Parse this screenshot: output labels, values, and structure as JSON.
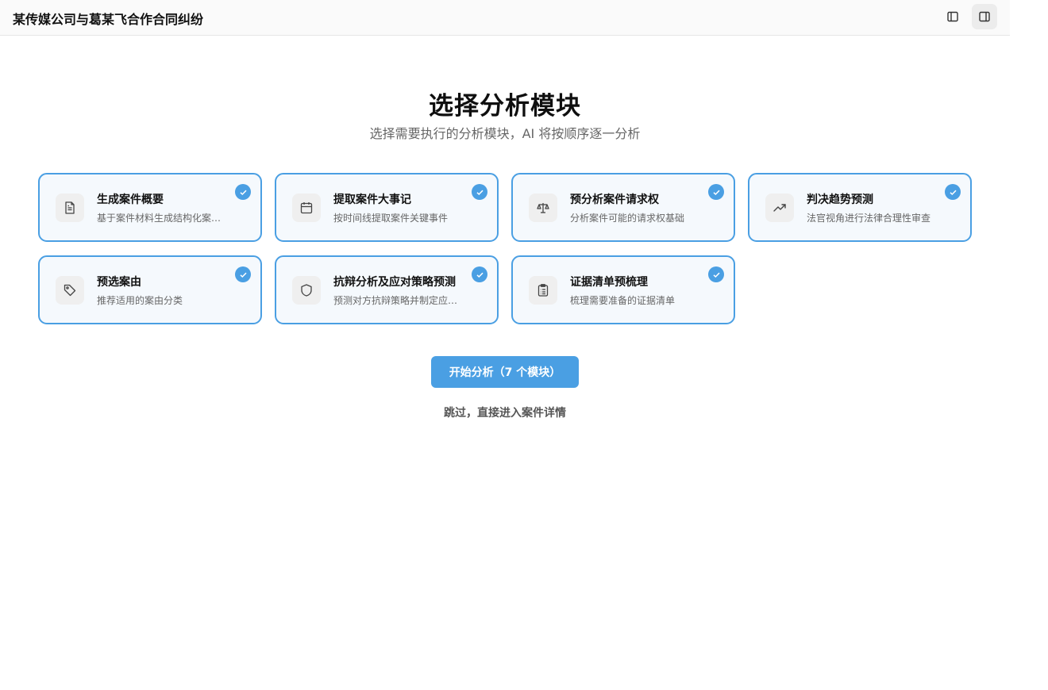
{
  "header": {
    "case_title": "某传媒公司与葛某飞合作合同纠纷",
    "buttons": [
      {
        "icon": "panel-left-icon",
        "active": false
      },
      {
        "icon": "panel-right-icon",
        "active": true
      }
    ]
  },
  "page": {
    "title": "选择分析模块",
    "subtitle": "选择需要执行的分析模块，AI 将按顺序逐一分析"
  },
  "modules": [
    {
      "title": "生成案件概要",
      "desc": "基于案件材料生成结构化案件概要",
      "icon": "file-text-icon",
      "selected": true
    },
    {
      "title": "提取案件大事记",
      "desc": "按时间线提取案件关键事件",
      "icon": "calendar-icon",
      "selected": true
    },
    {
      "title": "预分析案件请求权",
      "desc": "分析案件可能的请求权基础",
      "icon": "scale-icon",
      "selected": true
    },
    {
      "title": "判决趋势预测",
      "desc": "法官视角进行法律合理性审查",
      "icon": "trending-up-icon",
      "selected": true
    },
    {
      "title": "预选案由",
      "desc": "推荐适用的案由分类",
      "icon": "tag-icon",
      "selected": true
    },
    {
      "title": "抗辩分析及应对策略预测",
      "desc": "预测对方抗辩策略并制定应对方案",
      "icon": "shield-icon",
      "selected": true
    },
    {
      "title": "证据清单预梳理",
      "desc": "梳理需要准备的证据清单",
      "icon": "clipboard-list-icon",
      "selected": true
    }
  ],
  "actions": {
    "start_label": "开始分析（7 个模块）",
    "skip_label": "跳过，直接进入案件详情"
  },
  "colors": {
    "accent": "#4a9fe3",
    "card_bg": "#f5f9fd"
  }
}
